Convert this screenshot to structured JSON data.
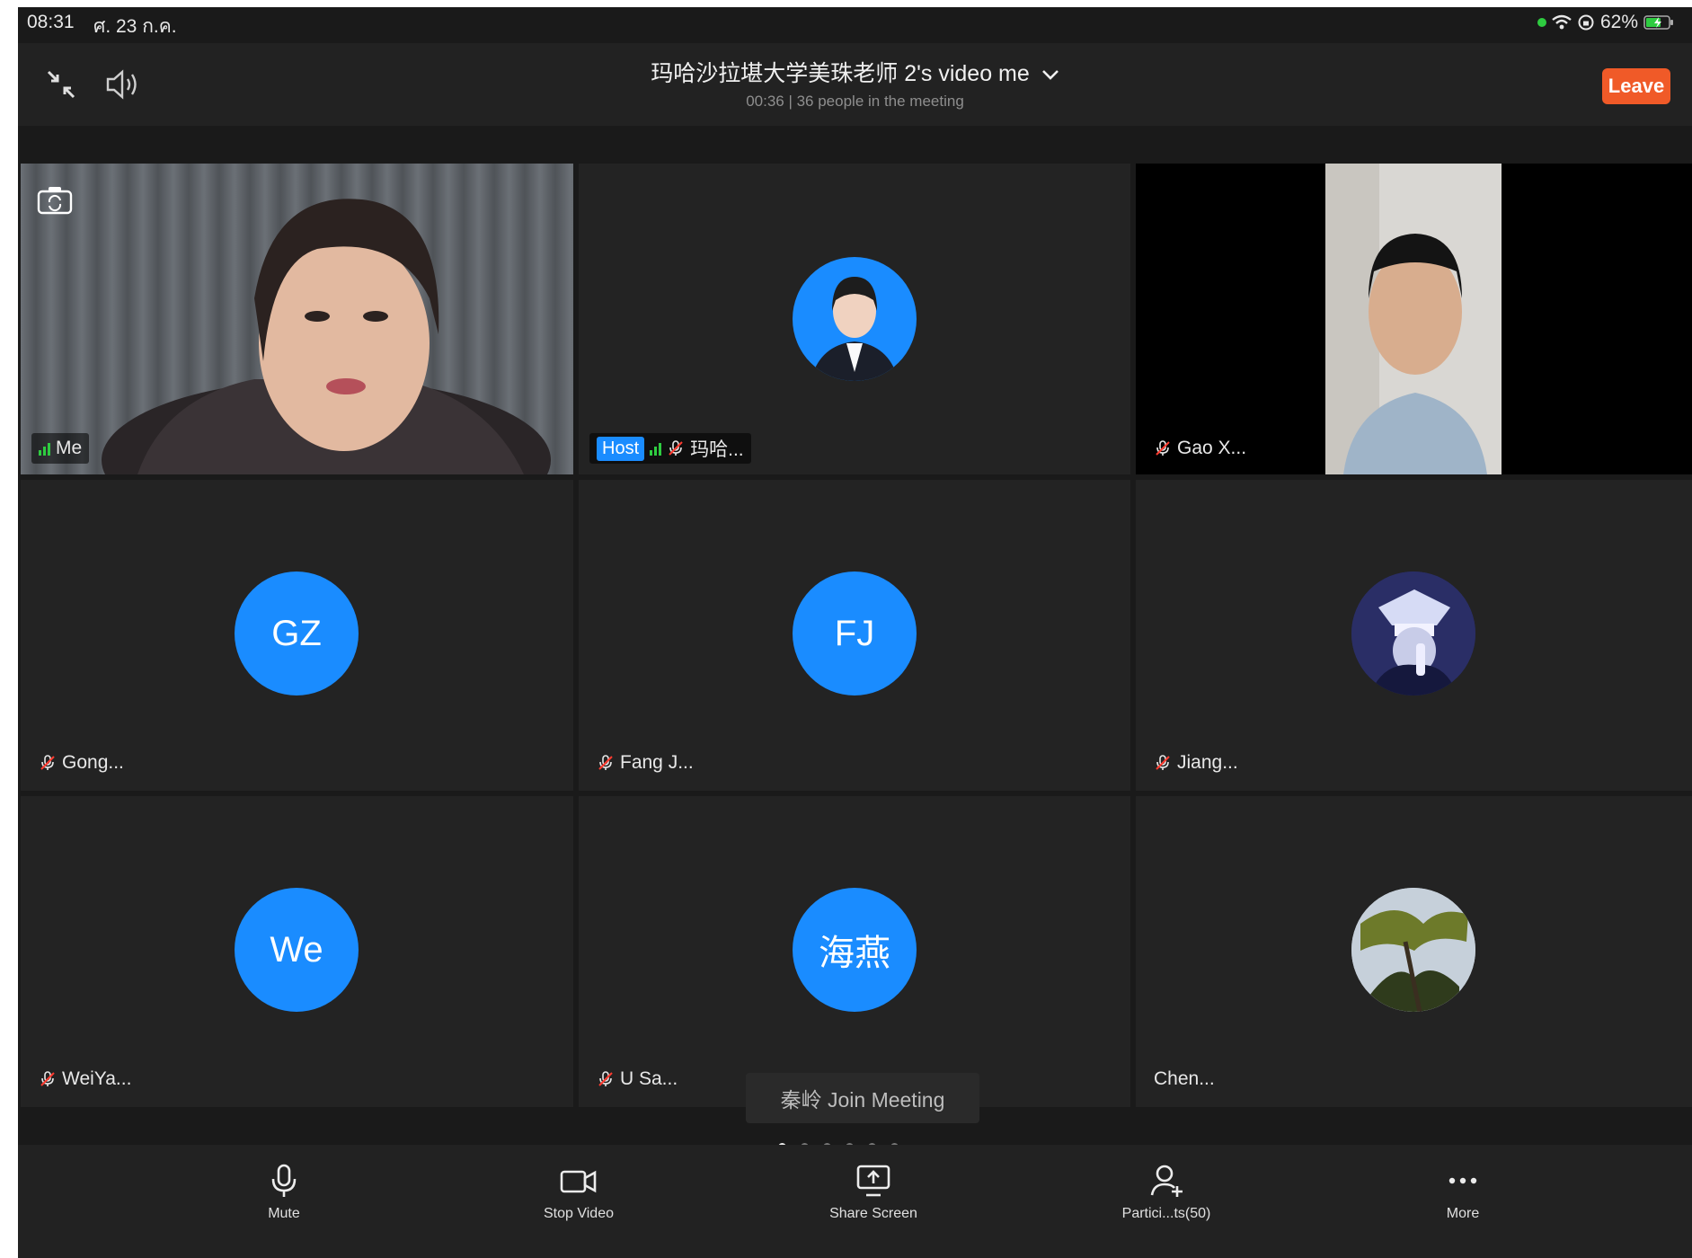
{
  "status_bar": {
    "time": "08:31",
    "date": "ศ. 23 ก.ค.",
    "battery": "62%"
  },
  "header": {
    "title": "玛哈沙拉堪大学美珠老师 2's video me",
    "subtitle": "00:36 | 36 people in the meeting",
    "leave_label": "Leave"
  },
  "participants": [
    {
      "name": "Me",
      "avatar_text": ""
    },
    {
      "name": "玛哈...",
      "host_label": "Host",
      "avatar_text": ""
    },
    {
      "name": "Gao X...",
      "avatar_text": ""
    },
    {
      "name": "Gong...",
      "avatar_text": "GZ"
    },
    {
      "name": "Fang J...",
      "avatar_text": "FJ"
    },
    {
      "name": "Jiang...",
      "avatar_text": ""
    },
    {
      "name": "WeiYa...",
      "avatar_text": "We"
    },
    {
      "name": "U Sa...",
      "avatar_text": "海燕"
    },
    {
      "name": "Chen...",
      "avatar_text": ""
    }
  ],
  "toast": {
    "text": "秦岭 Join Meeting"
  },
  "toolbar": {
    "mute_label": "Mute",
    "stop_video_label": "Stop Video",
    "share_screen_label": "Share Screen",
    "participants_label": "Partici...ts(50)",
    "more_label": "More"
  },
  "colors": {
    "accent_blue": "#1a8cff",
    "leave_orange": "#f05a28",
    "background": "#1a1a1a"
  }
}
